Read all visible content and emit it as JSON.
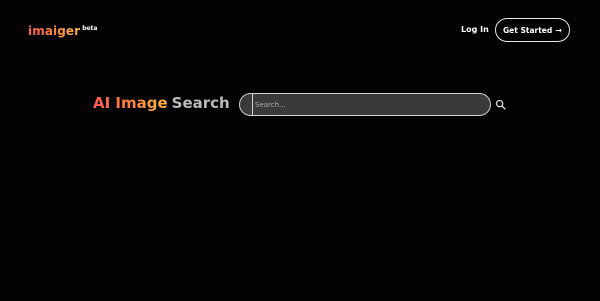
{
  "header": {
    "logo_text": "imaiger",
    "logo_badge": "beta",
    "login_label": "Log In",
    "cta_label": "Get Started",
    "cta_arrow": "→"
  },
  "hero": {
    "title_part1": "AI Image",
    "title_part2": "Search"
  },
  "search": {
    "placeholder": "Search...",
    "icon": "search-icon"
  },
  "colors": {
    "background": "#030303",
    "accent_start": "#ff5a4f",
    "accent_end": "#ffb347",
    "muted_text": "#b9b9b9"
  }
}
